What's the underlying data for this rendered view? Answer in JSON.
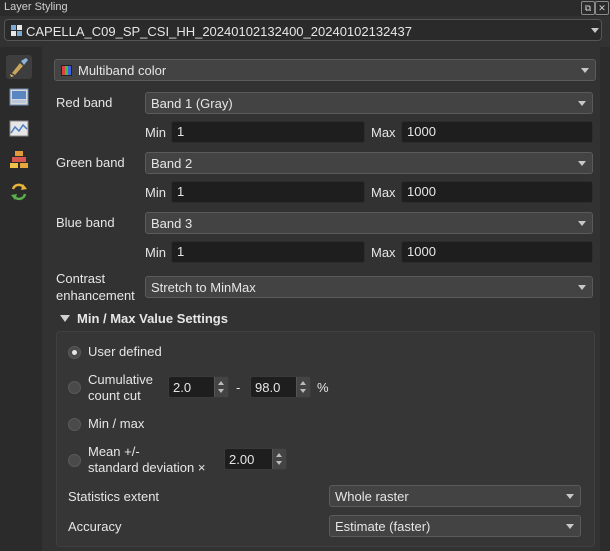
{
  "window": {
    "title": "Layer Styling"
  },
  "layer": {
    "name": "CAPELLA_C09_SP_CSI_HH_20240102132400_20240102132437"
  },
  "renderer": {
    "type": "Multiband color"
  },
  "bands": {
    "red": {
      "label": "Red band",
      "band": "Band 1 (Gray)",
      "min_label": "Min",
      "min": "1",
      "max_label": "Max",
      "max": "1000"
    },
    "green": {
      "label": "Green band",
      "band": "Band 2",
      "min_label": "Min",
      "min": "1",
      "max_label": "Max",
      "max": "1000"
    },
    "blue": {
      "label": "Blue band",
      "band": "Band 3",
      "min_label": "Min",
      "min": "1",
      "max_label": "Max",
      "max": "1000"
    }
  },
  "contrast": {
    "label_line1": "Contrast",
    "label_line2": "enhancement",
    "value": "Stretch to MinMax"
  },
  "minmax": {
    "title": "Min / Max Value Settings",
    "user_defined": "User defined",
    "cumulative_line1": "Cumulative",
    "cumulative_line2": "count cut",
    "cum_low": "2.0",
    "dash": "-",
    "cum_high": "98.0",
    "percent": "%",
    "minmax": "Min / max",
    "mean_line1": "Mean +/-",
    "mean_line2": "standard deviation ×",
    "stddev": "2.00",
    "stats_extent_label": "Statistics extent",
    "stats_extent_value": "Whole raster",
    "accuracy_label": "Accuracy",
    "accuracy_value": "Estimate (faster)"
  }
}
